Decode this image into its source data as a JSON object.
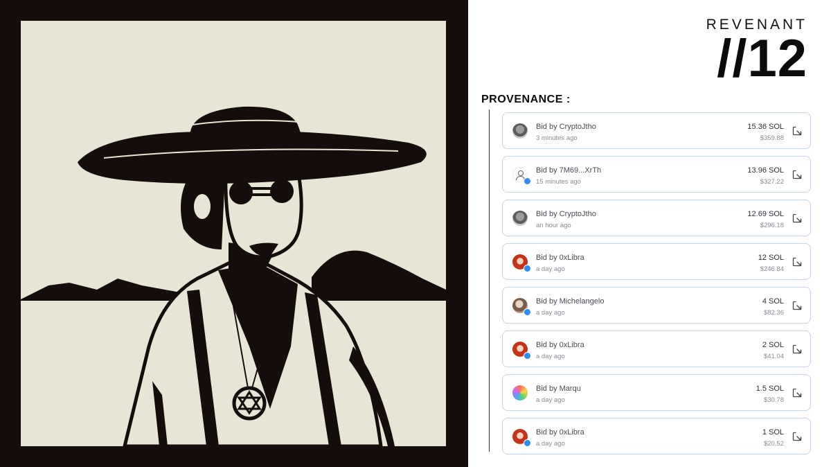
{
  "header": {
    "collection": "REVENANT",
    "edition": "//12"
  },
  "provenance": {
    "heading": "PROVENANCE :",
    "bids": [
      {
        "prefix": "Bid by",
        "bidder": "CryptoJtho",
        "time": "3 minutes ago",
        "amount": "15.36 SOL",
        "usd": "$359.88",
        "avatar": "cryptojtho",
        "verified": false
      },
      {
        "prefix": "Bid by",
        "bidder": "7M69...XrTh",
        "time": "15 minutes ago",
        "amount": "13.96 SOL",
        "usd": "$327.22",
        "avatar": "anon",
        "verified": true
      },
      {
        "prefix": "Bid by",
        "bidder": "CryptoJtho",
        "time": "an hour ago",
        "amount": "12.69 SOL",
        "usd": "$296.18",
        "avatar": "cryptojtho",
        "verified": false
      },
      {
        "prefix": "Bid by",
        "bidder": "0xLibra",
        "time": "a day ago",
        "amount": "12 SOL",
        "usd": "$246.84",
        "avatar": "oxlibra",
        "verified": true
      },
      {
        "prefix": "Bid by",
        "bidder": "Michelangelo",
        "time": "a day ago",
        "amount": "4 SOL",
        "usd": "$82.36",
        "avatar": "michelangelo",
        "verified": true
      },
      {
        "prefix": "Bid by",
        "bidder": "0xLibra",
        "time": "a day ago",
        "amount": "2 SOL",
        "usd": "$41.04",
        "avatar": "oxlibra",
        "verified": true
      },
      {
        "prefix": "Bid by",
        "bidder": "Marqu",
        "time": "a day ago",
        "amount": "1.5 SOL",
        "usd": "$30.78",
        "avatar": "marqu",
        "verified": false
      },
      {
        "prefix": "Bid by",
        "bidder": "0xLibra",
        "time": "a day ago",
        "amount": "1 SOL",
        "usd": "$20.52",
        "avatar": "oxlibra",
        "verified": true
      }
    ]
  },
  "icons": {
    "avatar_placeholder": "user-icon",
    "row_action": "external-link-icon",
    "verified": "verified-badge-icon"
  },
  "colors": {
    "frame": "#150d0b",
    "canvas": "#e7e5d6",
    "card_border": "#c6d3ee",
    "verified": "#2f8cf0"
  }
}
